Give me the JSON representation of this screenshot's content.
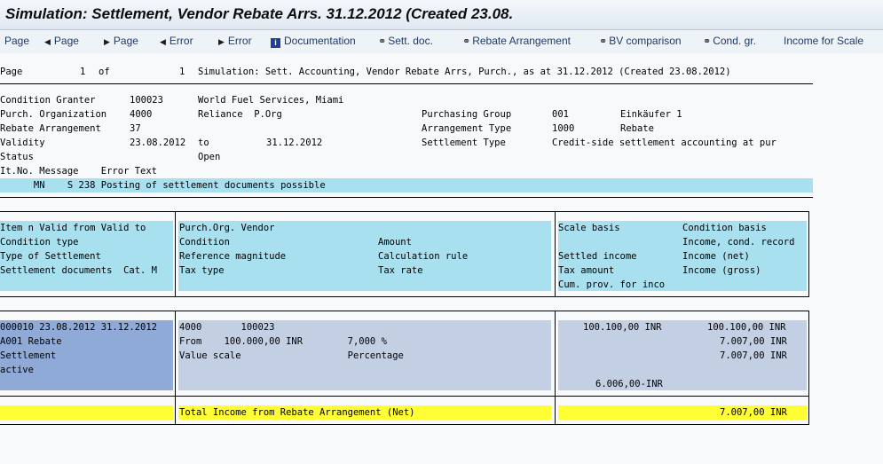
{
  "window": {
    "title": "Simulation: Settlement, Vendor Rebate Arrs. 31.12.2012 (Created 23.08."
  },
  "toolbar": {
    "page_first": "Page",
    "page_prev": "Page",
    "page_next": "Page",
    "error_prev": "Error",
    "error_next": "Error",
    "documentation": "Documentation",
    "sett_doc": "Sett. doc.",
    "rebate_arrangement": "Rebate Arrangement",
    "bv_comparison": "BV comparison",
    "cond_gr": "Cond. gr.",
    "income_for_scale": "Income for Scale"
  },
  "header": {
    "page_label": "Page",
    "page_num": "1",
    "of_label": "of",
    "page_total": "1",
    "description": "Simulation: Sett. Accounting, Vendor Rebate Arrs, Purch., as at 31.12.2012 (Created 23.08.2012)"
  },
  "info": {
    "condition_granter_label": "Condition Granter",
    "condition_granter_value": "100023",
    "condition_granter_name": "World Fuel Services, Miami",
    "purch_org_label": "Purch. Organization",
    "purch_org_value": "4000",
    "purch_org_name": "Reliance  P.Org",
    "rebate_arr_label": "Rebate Arrangement",
    "rebate_arr_value": "37",
    "validity_label": "Validity",
    "validity_from": "23.08.2012",
    "validity_to_label": "to",
    "validity_to": "31.12.2012",
    "status_label": "Status",
    "status_value": "Open",
    "purch_group_label": "Purchasing Group",
    "purch_group_value": "001",
    "purch_group_name": "Einkäufer 1",
    "arr_type_label": "Arrangement Type",
    "arr_type_value": "1000",
    "arr_type_name": "Rebate",
    "sett_type_label": "Settlement Type",
    "sett_type_value": "Credit-side settlement accounting at pur"
  },
  "messages": {
    "header": "It.No. Message    Error Text",
    "row": "      MN    S 238 Posting of settlement documents possible"
  },
  "table_header": {
    "left": [
      "Item n Valid from Valid to",
      "Condition type",
      "Type of Settlement",
      "Settlement documents  Cat. M",
      ""
    ],
    "mid_a": [
      "Purch.Org. Vendor",
      "Condition",
      "Reference magnitude",
      "Tax type",
      ""
    ],
    "mid_b": [
      "",
      "Amount",
      "Calculation rule",
      "Tax rate",
      ""
    ],
    "right_a": [
      "Scale basis",
      "",
      "Settled income",
      "Tax amount",
      "Cum. prov. for inco"
    ],
    "right_b": [
      "Condition basis",
      "Income, cond. record",
      "Income (net)",
      "Income (gross)",
      ""
    ]
  },
  "table_data": {
    "left": [
      "000010 23.08.2012 31.12.2012",
      "A001 Rebate",
      "Settlement",
      "active",
      ""
    ],
    "mid": [
      "4000       100023",
      "From    100.000,00 INR        7,000 %",
      "Value scale                   Percentage",
      "",
      ""
    ],
    "right_a": [
      "100.100,00 INR",
      "",
      "",
      "",
      "6.006,00-INR"
    ],
    "right_b": [
      "100.100,00 INR",
      "7.007,00 INR",
      "7.007,00 INR",
      "",
      ""
    ]
  },
  "total": {
    "label": "Total Income from Rebate Arrangement (Net)",
    "value": "7.007,00 INR"
  },
  "colors": {
    "highlight": "#a8e0f0",
    "row_band": "#c3d0e4",
    "selected_row": "#8faad6",
    "total": "#ffff33"
  }
}
